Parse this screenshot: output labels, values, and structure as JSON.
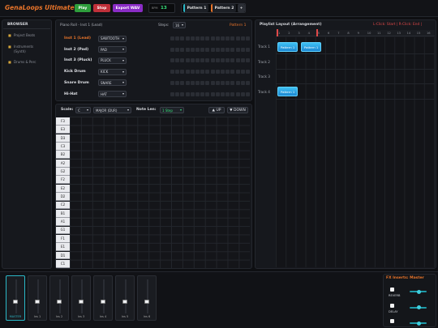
{
  "header": {
    "title": "GenaLoops Ultimate",
    "play": "Play",
    "stop": "Stop",
    "export": "Export WAV",
    "bpm_label": "BPM",
    "bpm_value": "13",
    "pattern_tabs": [
      "Pattern 1",
      "Pattern 2"
    ],
    "add_pattern": "+"
  },
  "browser": {
    "title": "BROWSER",
    "items": [
      "Project Beats",
      "Instruments (Synth)",
      "Drums & Perc"
    ]
  },
  "instruments": {
    "title": "Piano Roll - Inst 1 (Lead)",
    "steps_label": "Steps:",
    "steps_value": "16",
    "pattern_label": "Pattern 1",
    "rows": [
      {
        "name": "Inst 1 (Lead)",
        "wave": "SAWTOOTH",
        "active": true
      },
      {
        "name": "Inst 2 (Pad)",
        "wave": "PAD",
        "active": false
      },
      {
        "name": "Inst 3 (Pluck)",
        "wave": "PLUCK",
        "active": false
      },
      {
        "name": "Kick Drum",
        "wave": "KICK",
        "active": false
      },
      {
        "name": "Snare Drum",
        "wave": "SNARE",
        "active": false
      },
      {
        "name": "Hi-Hat",
        "wave": "HAT",
        "active": false
      }
    ]
  },
  "piano": {
    "scale_label": "Scale:",
    "root": "C",
    "mode": "MAJOR (DUR)",
    "note_len_label": "Note Len:",
    "note_len": "1 Step",
    "up": "▲ UP",
    "down": "▼ DOWN",
    "keys": [
      "F3",
      "E3",
      "D3",
      "C3",
      "B2",
      "A2",
      "G2",
      "F2",
      "E2",
      "D2",
      "C2",
      "B1",
      "A1",
      "G1",
      "F1",
      "E1",
      "D1",
      "C1"
    ]
  },
  "playlist": {
    "title": "Playlist Layout (Arrangement)",
    "hint": "L-Click: Start | R-Click: End |",
    "ruler": [
      "1",
      "2",
      "3",
      "4",
      "5",
      "6",
      "7",
      "8",
      "9",
      "10",
      "11",
      "12",
      "13",
      "14",
      "15",
      "16"
    ],
    "tracks": [
      "Track 1",
      "Track 2",
      "Track 3",
      "Track 4"
    ],
    "clips": [
      {
        "track": 1,
        "label": "Pattern 1"
      },
      {
        "track": 1,
        "label": "Pattern 1"
      },
      {
        "track": 4,
        "label": "Pattern 1"
      }
    ]
  },
  "mixer": {
    "channels": [
      {
        "name": "MASTER",
        "level": 0.35
      },
      {
        "name": "Ins 1",
        "level": 0.35
      },
      {
        "name": "Ins 2",
        "level": 0.35
      },
      {
        "name": "Ins 3",
        "level": 0.35
      },
      {
        "name": "Ins 4",
        "level": 0.35
      },
      {
        "name": "Ins 5",
        "level": 0.35
      },
      {
        "name": "Ins 6",
        "level": 0.35
      }
    ]
  },
  "fx": {
    "title": "FX Inserts: Master",
    "items": [
      {
        "name": "REVERB",
        "level": 0.55
      },
      {
        "name": "DELAY",
        "level": 0.55
      },
      {
        "name": "",
        "level": 0.55
      }
    ]
  },
  "colors": {
    "accent": "#e8742a",
    "play": "#2e9e3c",
    "stop": "#c0303a",
    "export": "#8a2cc6",
    "clip": "#2aa6e8",
    "mixer_accent": "#2bb8c7"
  }
}
